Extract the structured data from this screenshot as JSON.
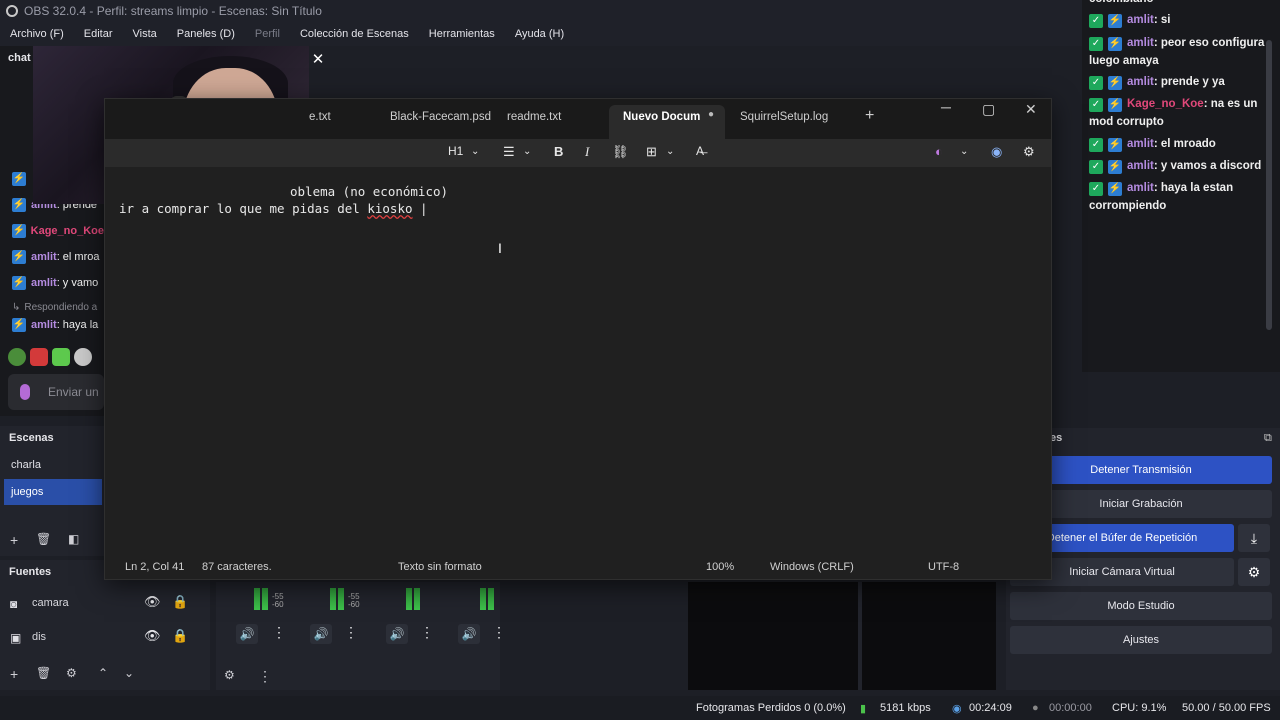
{
  "window": {
    "title": "OBS 32.0.4 - Perfil: streams limpio - Escenas: Sin Título"
  },
  "menu": {
    "items": [
      "Archivo (F)",
      "Editar",
      "Vista",
      "Paneles (D)",
      "Perfil",
      "Colección de Escenas",
      "Herramientas",
      "Ayuda (H)"
    ]
  },
  "chat_left": {
    "header": "chat",
    "rows": [
      {
        "user": "amlit",
        "msg": ": prende"
      },
      {
        "user": "Kage_no_Koe",
        "msg": ""
      },
      {
        "user": "amlit",
        "msg": ": el mroa"
      },
      {
        "user": "amlit",
        "msg": ": y vamo"
      },
      {
        "user": "amlit",
        "msg": ": haya la"
      }
    ],
    "replying": "Respondiendo a",
    "input_placeholder": "Enviar un"
  },
  "chat_right": {
    "top_cut": "colombiano",
    "rows": [
      {
        "user": "amlit",
        "msg": ": si"
      },
      {
        "user": "amlit",
        "msg": ": peor eso configura luego amaya"
      },
      {
        "user": "amlit",
        "msg": ": prende y ya"
      },
      {
        "user": "Kage_no_Koe",
        "msg": ": na es un mod corrupto"
      },
      {
        "user": "amlit",
        "msg": ": el mroado"
      },
      {
        "user": "amlit",
        "msg": ": y vamos a discord"
      },
      {
        "user": "amlit",
        "msg": ": haya la estan corrompiendo"
      }
    ]
  },
  "scenes": {
    "title": "Escenas",
    "items": [
      "charla",
      "juegos"
    ],
    "selected": "juegos"
  },
  "sources": {
    "title": "Fuentes",
    "items": [
      "camara",
      "dis"
    ]
  },
  "mixer": {
    "db_labels": [
      "-55",
      "-60"
    ]
  },
  "controls": {
    "title": "es",
    "buttons": [
      "Detener Transmisión",
      "Iniciar Grabación",
      "Detener el Búfer de Repetición",
      "Iniciar Cámara Virtual",
      "Modo Estudio",
      "Ajustes"
    ]
  },
  "statusbar": {
    "dropped": "Fotogramas Perdidos 0 (0.0%)",
    "bitrate": "5181 kbps",
    "stream_time": "00:24:09",
    "rec_time": "00:00:00",
    "cpu": "CPU: 9.1%",
    "fps": "50.00 / 50.00 FPS"
  },
  "notepad": {
    "tabs": [
      "e.txt",
      "Black-Facecam.psd",
      "readme.txt",
      "Nuevo Docum",
      "SquirrelSetup.log"
    ],
    "active_tab": "Nuevo Docum",
    "heading_label": "H1",
    "line1": "oblema (no económico)",
    "line2_a": "ir a comprar lo que me pidas del ",
    "line2_b": "kiosko",
    "status": {
      "position": "Ln 2, Col 41",
      "chars": "87 caracteres.",
      "format": "Texto sin formato",
      "zoom": "100%",
      "eol": "Windows (CRLF)",
      "encoding": "UTF-8"
    }
  }
}
